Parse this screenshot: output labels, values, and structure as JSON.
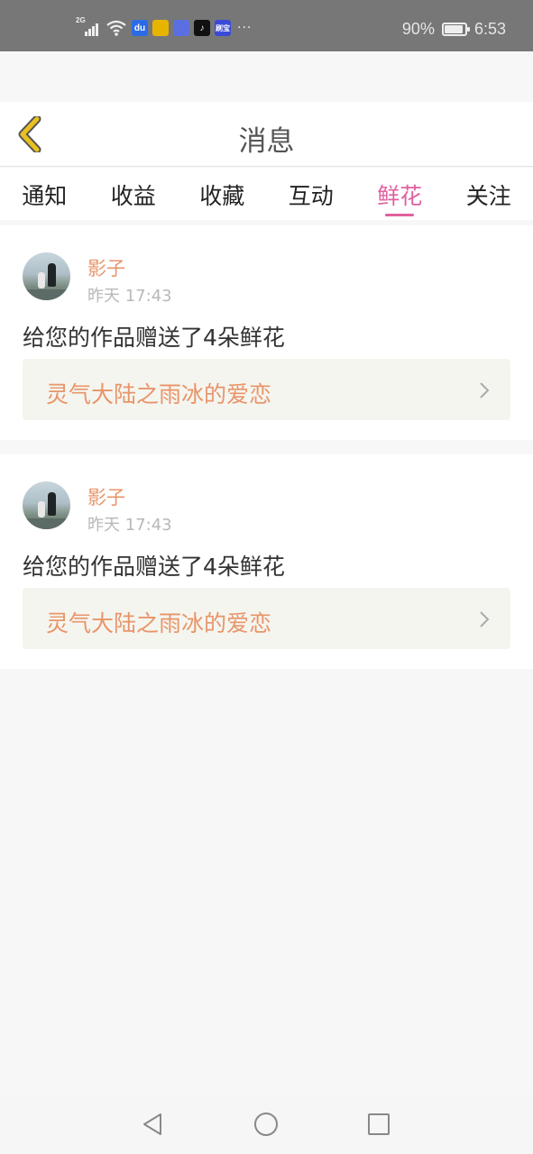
{
  "status_bar": {
    "network_type": "2G",
    "battery_percent": "90%",
    "battery_level": 0.9,
    "time": "6:53",
    "app_icons": [
      {
        "name": "baidu-icon",
        "label": "du",
        "color": "#2b6be6"
      },
      {
        "name": "lightbulb-icon",
        "label": "",
        "color": "#e8b400"
      },
      {
        "name": "app-icon",
        "label": "",
        "color": "#5b6fe0"
      },
      {
        "name": "tiktok-icon",
        "label": "♪",
        "color": "#111111"
      },
      {
        "name": "news-icon",
        "label": "刷宝",
        "color": "#3a4ad8"
      }
    ],
    "more_label": "···"
  },
  "header": {
    "title": "消息",
    "back_icon": "chevron-left-icon",
    "back_color": "#e8c020"
  },
  "tabs": [
    {
      "label": "通知",
      "active": false
    },
    {
      "label": "收益",
      "active": false
    },
    {
      "label": "收藏",
      "active": false
    },
    {
      "label": "互动",
      "active": false
    },
    {
      "label": "鲜花",
      "active": true
    },
    {
      "label": "关注",
      "active": false
    }
  ],
  "notifications": [
    {
      "username": "影子",
      "time": "昨天 17:43",
      "message": "给您的作品赠送了4朵鲜花",
      "work_title": "灵气大陆之雨冰的爱恋"
    },
    {
      "username": "影子",
      "time": "昨天 17:43",
      "message": "给您的作品赠送了4朵鲜花",
      "work_title": "灵气大陆之雨冰的爱恋"
    }
  ],
  "colors": {
    "accent": "#e0619f",
    "username": "#e8956a",
    "work_title": "#e8956a",
    "link_bg": "#f5f5ef"
  }
}
